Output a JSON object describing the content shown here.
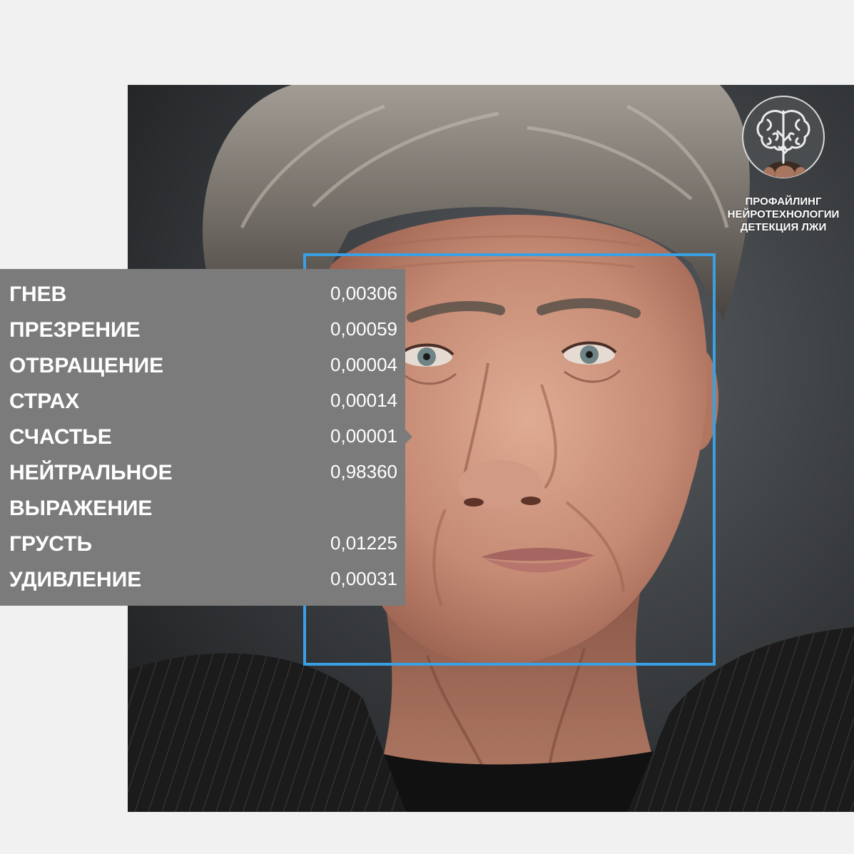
{
  "emotions": [
    {
      "label": "ГНЕВ",
      "value": "0,00306"
    },
    {
      "label": "ПРЕЗРЕНИЕ",
      "value": "0,00059"
    },
    {
      "label": "ОТВРАЩЕНИЕ",
      "value": "0,00004"
    },
    {
      "label": "СТРАХ",
      "value": "0,00014"
    },
    {
      "label": "СЧАСТЬЕ",
      "value": "0,00001"
    },
    {
      "label": "НЕЙТРАЛЬНОЕ ВЫРАЖЕНИЕ",
      "value": "0,98360"
    },
    {
      "label": "ГРУСТЬ",
      "value": "0,01225"
    },
    {
      "label": "УДИВЛЕНИЕ",
      "value": "0,00031"
    }
  ],
  "logo": {
    "icon": "brain-icon",
    "lines": [
      "ПРОФАЙЛИНГ",
      "НЕЙРОТЕХНОЛОГИИ",
      "ДЕТЕКЦИЯ ЛЖИ"
    ]
  },
  "colors": {
    "page_background": "#f1f1f1",
    "panel": "#7b7b7b",
    "detection_box": "#3aa0e4",
    "panel_text": "#ffffff"
  }
}
